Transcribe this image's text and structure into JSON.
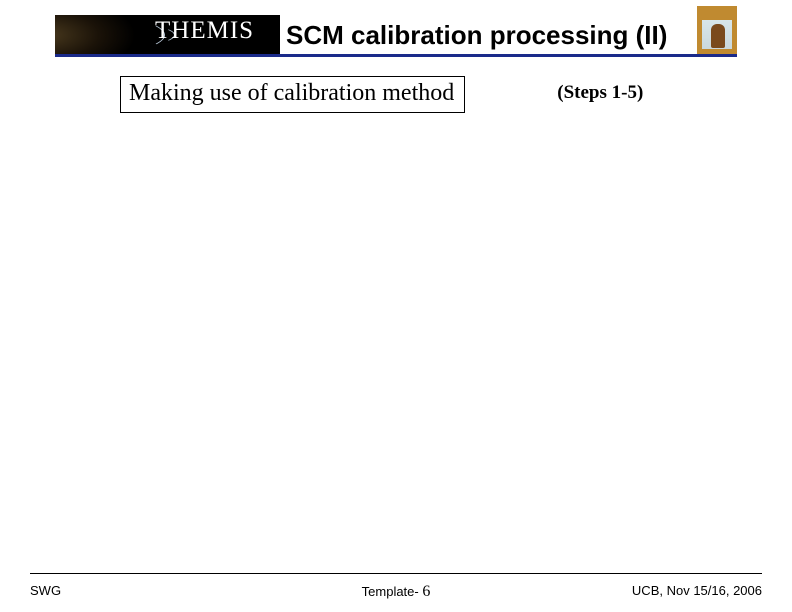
{
  "header": {
    "logo_text": "THEMIS",
    "title": "SCM calibration processing (II)"
  },
  "content": {
    "subheading": "Making use of calibration method",
    "steps_label": "(Steps 1-5)"
  },
  "footer": {
    "left": "SWG",
    "center_prefix": "Template- ",
    "page_number": "6",
    "right": "UCB, Nov 15/16, 2006"
  }
}
